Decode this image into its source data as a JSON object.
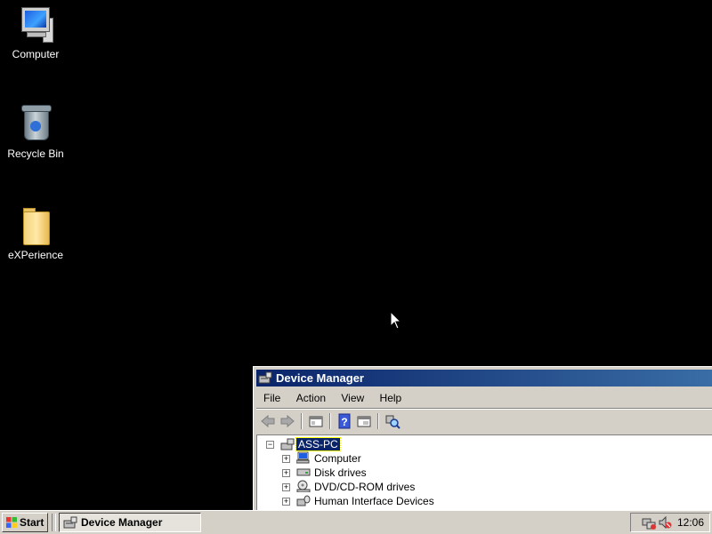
{
  "desktop": {
    "icons": [
      {
        "label": "Computer",
        "icon": "computer-icon"
      },
      {
        "label": "Recycle Bin",
        "icon": "recycle-bin-icon"
      },
      {
        "label": "eXPerience",
        "icon": "folder-icon"
      }
    ]
  },
  "window": {
    "title": "Device Manager",
    "menu": [
      "File",
      "Action",
      "View",
      "Help"
    ],
    "toolbar": [
      "back-icon",
      "forward-icon",
      "up-icon",
      "help-icon",
      "properties-icon",
      "scan-hardware-icon"
    ],
    "tree": {
      "root": "ASS-PC",
      "root_expander": "⊟",
      "children": [
        {
          "label": "Computer",
          "expander": "+"
        },
        {
          "label": "Disk drives",
          "expander": "+"
        },
        {
          "label": "DVD/CD-ROM drives",
          "expander": "+"
        },
        {
          "label": "Human Interface Devices",
          "expander": "+"
        }
      ]
    }
  },
  "taskbar": {
    "start_label": "Start",
    "tasks": [
      {
        "label": "Device Manager"
      }
    ],
    "clock": "12:06",
    "tray_icons": [
      "network-icon",
      "volume-muted-icon"
    ]
  },
  "colors": {
    "desktop": "#000000",
    "titlebar_start": "#0a246a",
    "titlebar_end": "#3a6ea5",
    "chrome": "#d4d0c8"
  }
}
